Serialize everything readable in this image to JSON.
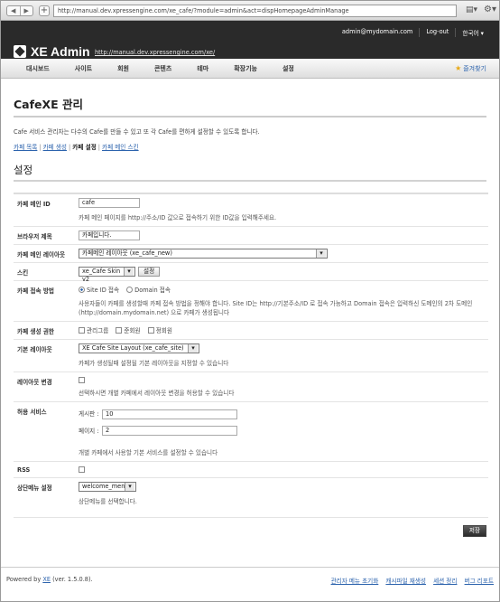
{
  "browser": {
    "url": "http://manual.dev.xpressengine.com/xe_cafe/?module=admin&act=dispHomepageAdminManage"
  },
  "header": {
    "user_email": "admin@mydomain.com",
    "logout": "Log-out",
    "language": "한국어 ▾",
    "logo_text": "XE Admin",
    "site_url": "http://manual.dev.xpressengine.com/xe/"
  },
  "menu": {
    "items": [
      "대시보드",
      "사이트",
      "회원",
      "콘텐츠",
      "테마",
      "확장기능",
      "설정"
    ],
    "favorites": "즐겨찾기"
  },
  "page": {
    "title": "CafeXE 관리",
    "description": "Cafe 서비스 관리자는 다수의 Cafe를 만들 수 있고 또 각 Cafe를 편하게 설정할 수 있도록 합니다.",
    "sublinks": [
      "카페 목록",
      "카페 생성",
      "카페 설정",
      "카페 메인 스킨"
    ],
    "section_title": "설정"
  },
  "form": {
    "cafe_main_id": {
      "label": "카페 메인 ID",
      "value": "cafe",
      "help": "카페 메인 페이지를 http://주소/ID 값으로 접속하기 위한 ID값을 입력해주세요."
    },
    "browser_title": {
      "label": "브라우저 제목",
      "value": "카페입니다."
    },
    "main_layout": {
      "label": "카페 메인 레이아웃",
      "value": "카페메인 레이아웃 (xe_cafe_new)"
    },
    "skin": {
      "label": "스킨",
      "value": "xe_Cafe Skin v2",
      "button": "설정"
    },
    "access_method": {
      "label": "카페 접속 방법",
      "option1": "Site ID 접속",
      "option2": "Domain 접속",
      "help": "사용자들이 카페를 생성할때 카페 접속 방법을 정해야 합니다. Site ID는 http://기본주소/ID 로 접속 가능하고 Domain 접속은 입력하신 도메인의 2차 도메인(http://domain.mydomain.net) 으로 카페가 생성됩니다"
    },
    "create_permission": {
      "label": "카페 생성 권한",
      "options": [
        "관리그룹",
        "준회원",
        "정회원"
      ]
    },
    "default_layout": {
      "label": "기본 레이아웃",
      "value": "XE Cafe Site Layout (xe_cafe_site)",
      "help": "카페가 생성될때 설정될 기본 레이아웃을 지정할 수 있습니다"
    },
    "layout_change": {
      "label": "레이아웃 변경",
      "help": "선택하시면 개별 카페에서 레이아웃 변경을 허용할 수 있습니다"
    },
    "allowed_services": {
      "label": "허용 서비스",
      "board_label": "게시판 :",
      "board_value": "10",
      "page_label": "페이지 :",
      "page_value": "2",
      "help": "개별 카페에서 사용할 기본 서비스를 설정할 수 있습니다"
    },
    "rss": {
      "label": "RSS"
    },
    "top_menu": {
      "label": "상단메뉴 설정",
      "value": "welcome_menu",
      "help": "상단메뉴를 선택합니다."
    },
    "save_button": "저장"
  },
  "footer": {
    "powered_prefix": "Powered by ",
    "powered_link": "XE",
    "version": " (ver. 1.5.0.8).",
    "links": [
      "관리자 메뉴 초기화",
      "캐시파일 재생성",
      "세션 정리",
      "버그 리포트"
    ]
  }
}
